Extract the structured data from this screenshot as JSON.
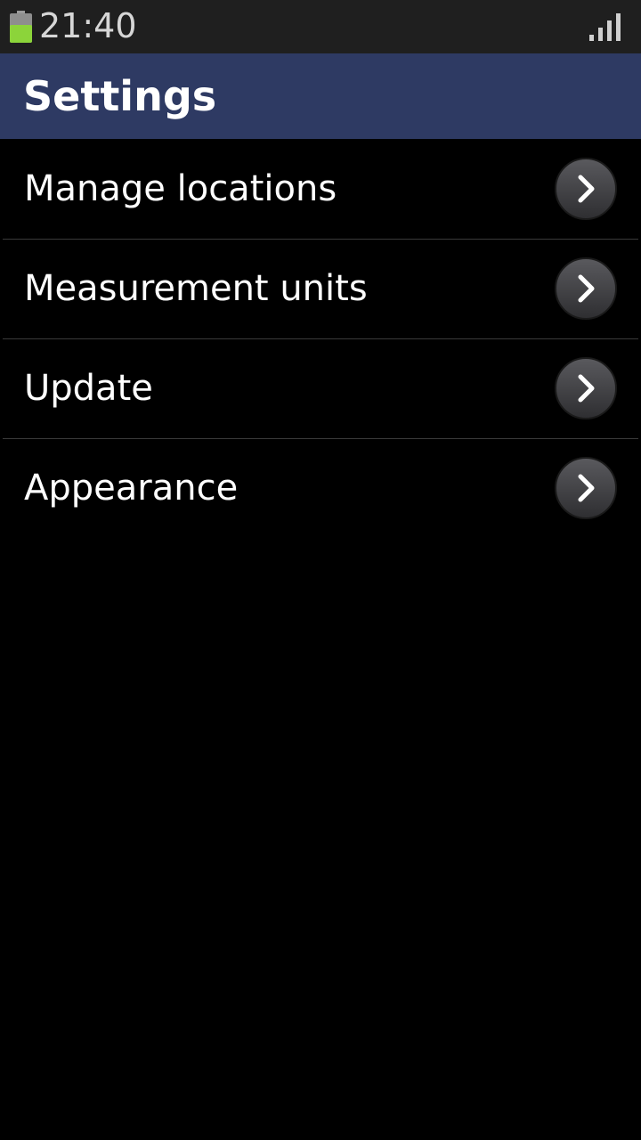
{
  "status_bar": {
    "time": "21:40",
    "battery_icon": "battery-icon",
    "battery_color": "#8cd43a",
    "signal_icon": "signal-bars-icon"
  },
  "app_bar": {
    "title": "Settings",
    "background_color": "#2e3a63"
  },
  "settings": {
    "items": [
      {
        "label": "Manage locations",
        "icon": "chevron-right-icon"
      },
      {
        "label": "Measurement units",
        "icon": "chevron-right-icon"
      },
      {
        "label": "Update",
        "icon": "chevron-right-icon"
      },
      {
        "label": "Appearance",
        "icon": "chevron-right-icon"
      }
    ]
  }
}
